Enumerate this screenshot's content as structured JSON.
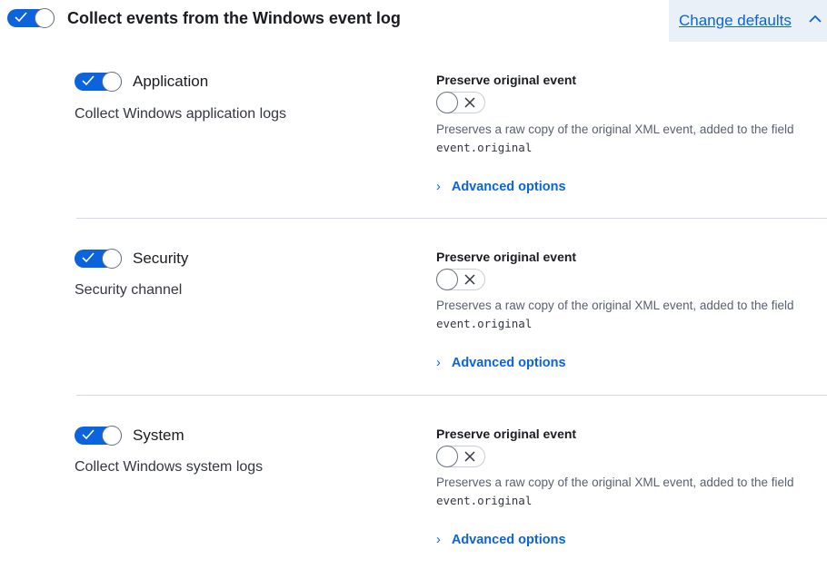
{
  "header": {
    "title": "Collect events from the Windows event log",
    "change_defaults_label": "Change defaults"
  },
  "colors": {
    "accent": "#0b64dd",
    "divider": "#d3dae6",
    "panel": "#e9f0f8"
  },
  "items": [
    {
      "label": "Application",
      "description": "Collect Windows application logs",
      "enabled": true,
      "preserve_title": "Preserve original event",
      "preserve_enabled": false,
      "help_text": "Preserves a raw copy of the original XML event, added to the field",
      "help_code": "event.original",
      "advanced_label": "Advanced options"
    },
    {
      "label": "Security",
      "description": "Security channel",
      "enabled": true,
      "preserve_title": "Preserve original event",
      "preserve_enabled": false,
      "help_text": "Preserves a raw copy of the original XML event, added to the field",
      "help_code": "event.original",
      "advanced_label": "Advanced options"
    },
    {
      "label": "System",
      "description": "Collect Windows system logs",
      "enabled": true,
      "preserve_title": "Preserve original event",
      "preserve_enabled": false,
      "help_text": "Preserves a raw copy of the original XML event, added to the field",
      "help_code": "event.original",
      "advanced_label": "Advanced options"
    }
  ]
}
